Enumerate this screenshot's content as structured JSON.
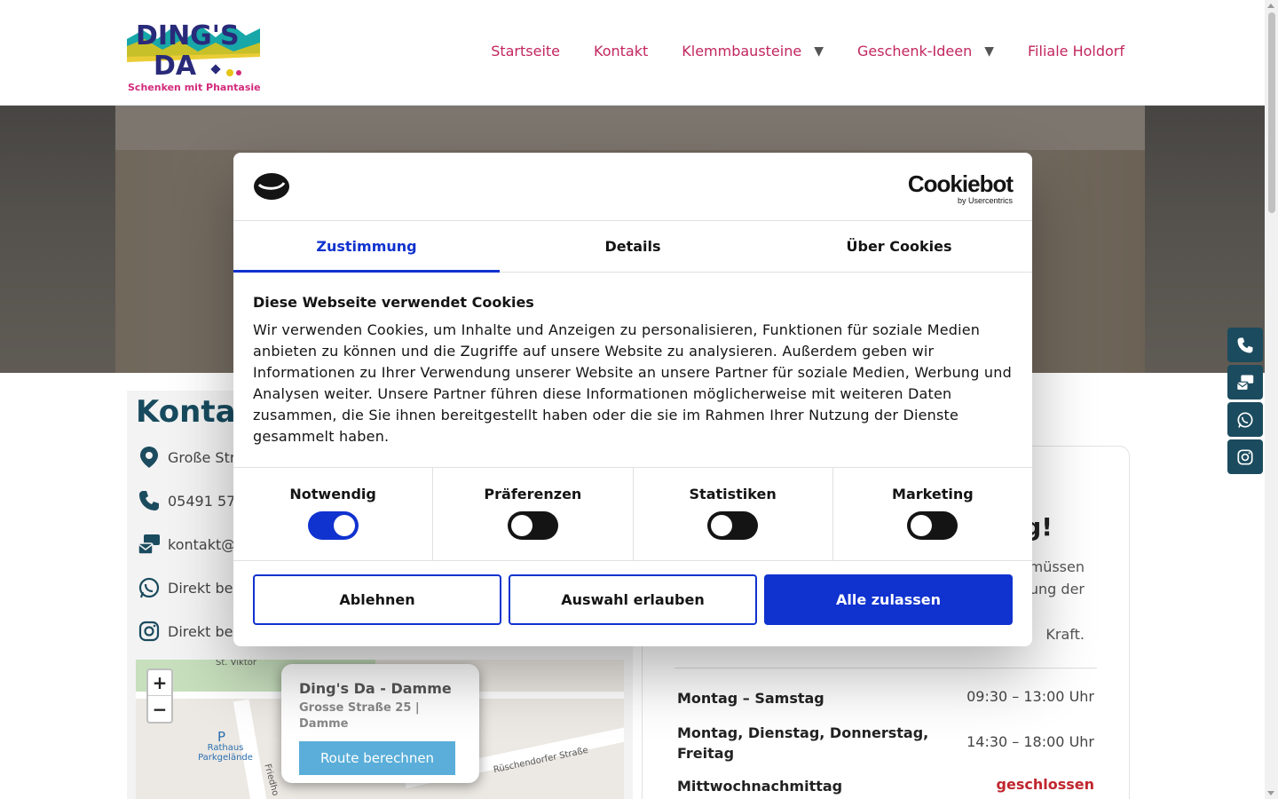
{
  "header": {
    "logo_text_top": "DING'S",
    "logo_text_bottom": "DA",
    "logo_tagline": "Schenken mit Phantasie!",
    "nav": [
      {
        "label": "Startseite",
        "dropdown": false
      },
      {
        "label": "Kontakt",
        "dropdown": false
      },
      {
        "label": "Klemmbausteine",
        "dropdown": true
      },
      {
        "label": "Geschenk-Ideen",
        "dropdown": true
      },
      {
        "label": "Filiale Holdorf",
        "dropdown": false
      }
    ],
    "caret": "▼"
  },
  "page": {
    "title": "Kontak",
    "contact_rows": [
      {
        "icon": "map-pin-icon",
        "text": "Große Str"
      },
      {
        "icon": "phone-icon",
        "text": "05491 57"
      },
      {
        "icon": "mail-icon",
        "text": "kontakt@"
      },
      {
        "icon": "whatsapp-icon",
        "text": "Direkt be"
      },
      {
        "icon": "instagram-icon",
        "text": "Direkt be"
      }
    ],
    "map": {
      "zoom_in": "+",
      "zoom_out": "−",
      "popup_title": "Ding's Da - Damme",
      "popup_address": "Grosse Straße 25 | Damme",
      "popup_button": "Route berechnen",
      "labels": [
        "St. Viktor",
        "Rathaus Parkgelände",
        "P",
        "Rüschendorfer Straße",
        "Friedho"
      ]
    },
    "right_card": {
      "heading_fragment": "g!",
      "text_fragments": [
        "müssen",
        "ung der",
        "Kraft."
      ]
    },
    "hours": [
      {
        "day": "Montag – Samstag",
        "time": "09:30 – 13:00 Uhr",
        "closed": false
      },
      {
        "day": "Montag, Dienstag, Donnerstag, Freitag",
        "time": "14:30 – 18:00 Uhr",
        "closed": false
      },
      {
        "day": "Mittwochnachmittag",
        "time": "geschlossen",
        "closed": true
      }
    ]
  },
  "social_bar": [
    "phone-icon",
    "mail-icon",
    "whatsapp-icon",
    "instagram-icon"
  ],
  "cookie_dialog": {
    "brand": "Cookiebot",
    "brand_sub": "by Usercentrics",
    "tabs": [
      {
        "label": "Zustimmung",
        "active": true
      },
      {
        "label": "Details",
        "active": false
      },
      {
        "label": "Über Cookies",
        "active": false
      }
    ],
    "heading": "Diese Webseite verwendet Cookies",
    "body": "Wir verwenden Cookies, um Inhalte und Anzeigen zu personalisieren, Funktionen für soziale Medien anbieten zu können und die Zugriffe auf unsere Website zu analysieren. Außerdem geben wir Informationen zu Ihrer Verwendung unserer Website an unsere Partner für soziale Medien, Werbung und Analysen weiter. Unsere Partner führen diese Informationen möglicherweise mit weiteren Daten zusammen, die Sie ihnen bereitgestellt haben oder die sie im Rahmen Ihrer Nutzung der Dienste gesammelt haben.",
    "toggles": [
      {
        "label": "Notwendig",
        "on": true
      },
      {
        "label": "Präferenzen",
        "on": false
      },
      {
        "label": "Statistiken",
        "on": false
      },
      {
        "label": "Marketing",
        "on": false
      }
    ],
    "buttons": {
      "decline": "Ablehnen",
      "allow_selection": "Auswahl erlauben",
      "allow_all": "Alle zulassen"
    },
    "colors": {
      "accent": "#1032cf",
      "text": "#141414"
    }
  },
  "colors": {
    "nav": "#c2265d",
    "brand_dark": "#1b4b5e",
    "closed": "#c0262d"
  }
}
